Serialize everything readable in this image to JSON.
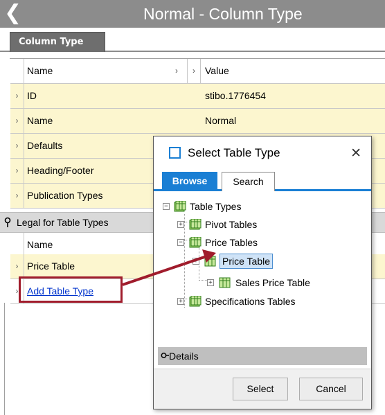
{
  "header": {
    "title": "Normal - Column Type",
    "back_icon": "back-chevron-icon"
  },
  "tabs": {
    "column_type": "Column Type"
  },
  "grid": {
    "header_name": "Name",
    "header_value": "Value",
    "rows": [
      {
        "name": "ID",
        "value": "stibo.1776454"
      },
      {
        "name": "Name",
        "value": "Normal"
      },
      {
        "name": "Defaults",
        "value": ""
      },
      {
        "name": "Heading/Footer",
        "value": ""
      },
      {
        "name": "Publication Types",
        "value": ""
      }
    ]
  },
  "legal": {
    "title": "Legal for Table Types",
    "header_name": "Name",
    "rows": [
      {
        "name": "Price Table"
      }
    ],
    "add_link": "Add Table Type"
  },
  "dialog": {
    "title": "Select Table Type",
    "close": "✕",
    "tabs": {
      "browse": "Browse",
      "search": "Search"
    },
    "tree": {
      "root": "Table Types",
      "pivot": "Pivot Tables",
      "price": "Price Tables",
      "price_table": "Price Table",
      "sales_price_table": "Sales Price Table",
      "spec": "Specifications Tables"
    },
    "details": "Details",
    "buttons": {
      "select": "Select",
      "cancel": "Cancel"
    }
  },
  "colors": {
    "accent": "#1a7fd4",
    "annotation": "#a01c2c",
    "row_yellow": "#fcf6cf",
    "titlebar": "#8c8c8c"
  }
}
